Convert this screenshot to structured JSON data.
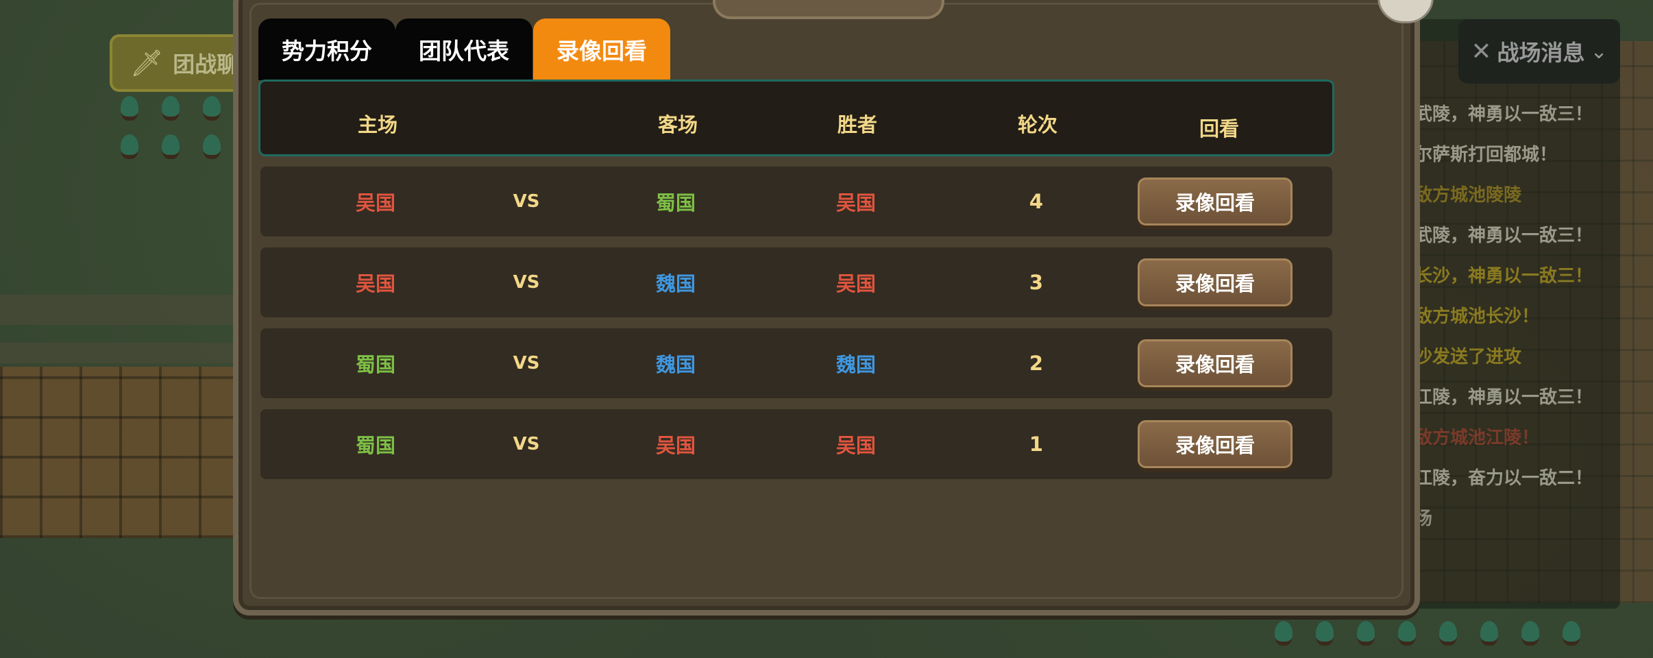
{
  "background": {
    "team_battle_label": "团战聊",
    "messages_header": "战场消息",
    "messages": [
      {
        "text": "武陵，神勇以一敌三！",
        "color": "#9a9a8a"
      },
      {
        "text": "尔萨斯打回都城！",
        "color": "#9a9a8a"
      },
      {
        "text": "敌方城池陵陵",
        "color": "#7a6a20"
      },
      {
        "text": "武陵，神勇以一敌三！",
        "color": "#9a9a8a"
      },
      {
        "text": "长沙，神勇以一敌三！",
        "color": "#8a7a20"
      },
      {
        "text": "敌方城池长沙！",
        "color": "#8a7a20"
      },
      {
        "text": "沙发送了进攻",
        "color": "#8a7a20"
      },
      {
        "text": "江陵，神勇以一敌三！",
        "color": "#9a9a8a"
      },
      {
        "text": "敌方城池江陵！",
        "color": "#7a3a2a"
      },
      {
        "text": "江陵，奋力以一敌二！",
        "color": "#9a9a8a"
      },
      {
        "text": "场",
        "color": "#8a8a7a"
      }
    ]
  },
  "tabs": [
    {
      "label": "势力积分",
      "active": false
    },
    {
      "label": "团队代表",
      "active": false
    },
    {
      "label": "录像回看",
      "active": true
    }
  ],
  "columns": {
    "home": "主场",
    "away": "客场",
    "winner": "胜者",
    "round": "轮次",
    "replay": "回看"
  },
  "vs_label": "VS",
  "replay_button_label": "录像回看",
  "rows": [
    {
      "home": "吴国",
      "away": "蜀国",
      "winner": "吴国",
      "round": "4"
    },
    {
      "home": "吴国",
      "away": "魏国",
      "winner": "吴国",
      "round": "3"
    },
    {
      "home": "蜀国",
      "away": "魏国",
      "winner": "魏国",
      "round": "2"
    },
    {
      "home": "蜀国",
      "away": "吴国",
      "winner": "吴国",
      "round": "1"
    }
  ],
  "faction_colors": {
    "吴国": "#e0553f",
    "蜀国": "#7dbf45",
    "魏国": "#3f97e0"
  }
}
